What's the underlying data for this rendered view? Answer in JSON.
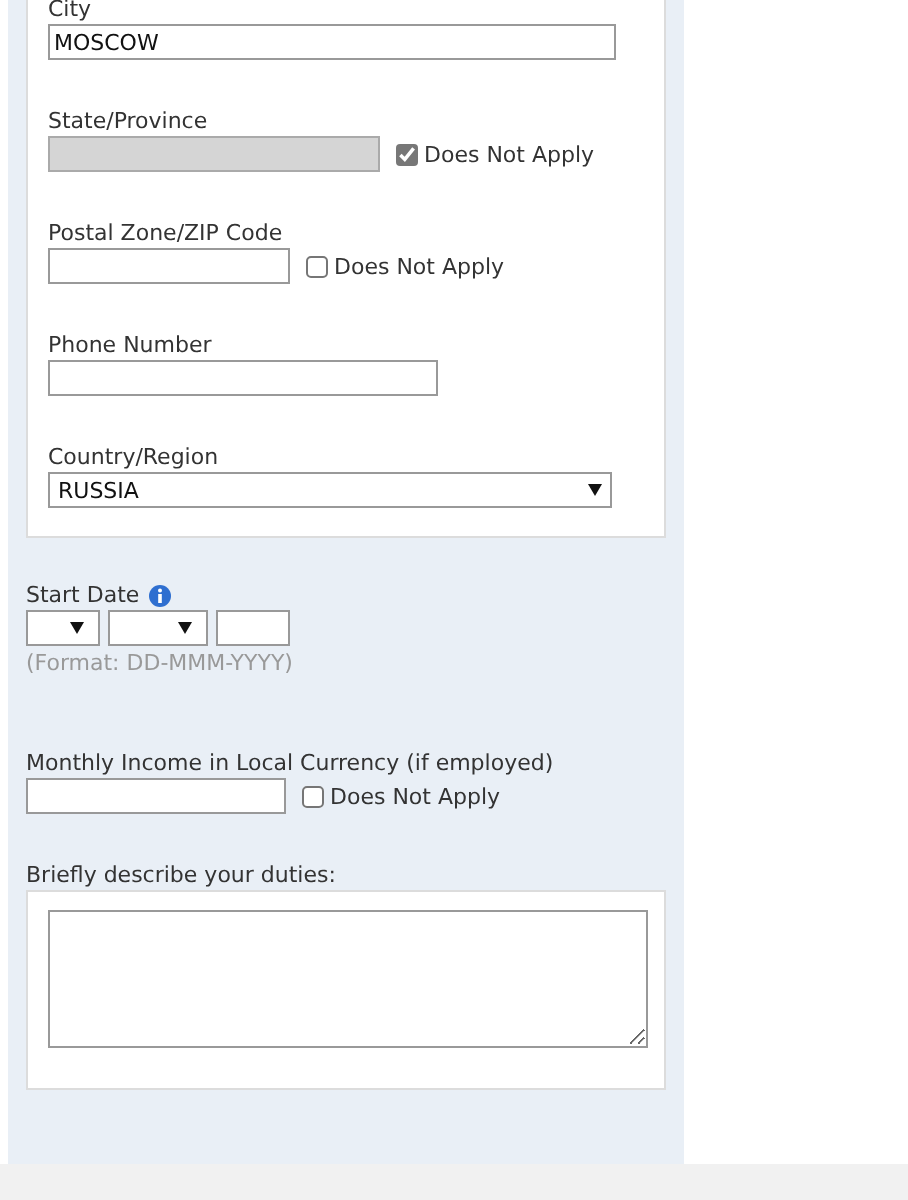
{
  "address_card": {
    "fields": [
      {
        "label": "City",
        "value": "MOSCOW",
        "disabled": false
      },
      {
        "label": "State/Province",
        "disabled": true,
        "does_not_apply": {
          "label": "Does Not Apply",
          "checked": true
        }
      },
      {
        "label": "Postal Zone/ZIP Code",
        "disabled": false,
        "does_not_apply": {
          "label": "Does Not Apply",
          "checked": false
        }
      },
      {
        "label": "Phone Number",
        "disabled": false
      },
      {
        "label": "Country/Region",
        "kind": "select",
        "value": "RUSSIA"
      }
    ]
  },
  "start_date": {
    "label": "Start Date",
    "hint": "(Format: DD-MMM-YYYY)"
  },
  "monthly_income": {
    "label": "Monthly Income in Local Currency (if employed)",
    "disabled": false,
    "does_not_apply": {
      "label": "Does Not Apply",
      "checked": false
    }
  },
  "duties": {
    "label": "Briefly describe your duties:"
  }
}
